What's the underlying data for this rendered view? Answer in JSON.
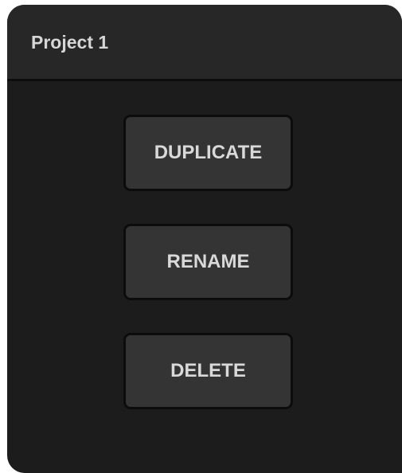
{
  "dialog": {
    "title": "Project 1"
  },
  "actions": {
    "duplicate_label": "DUPLICATE",
    "rename_label": "RENAME",
    "delete_label": "DELETE"
  },
  "colors": {
    "panel_background": "#1c1c1c",
    "header_background": "#272727",
    "button_background": "#343434",
    "text": "#d9d9d9"
  }
}
